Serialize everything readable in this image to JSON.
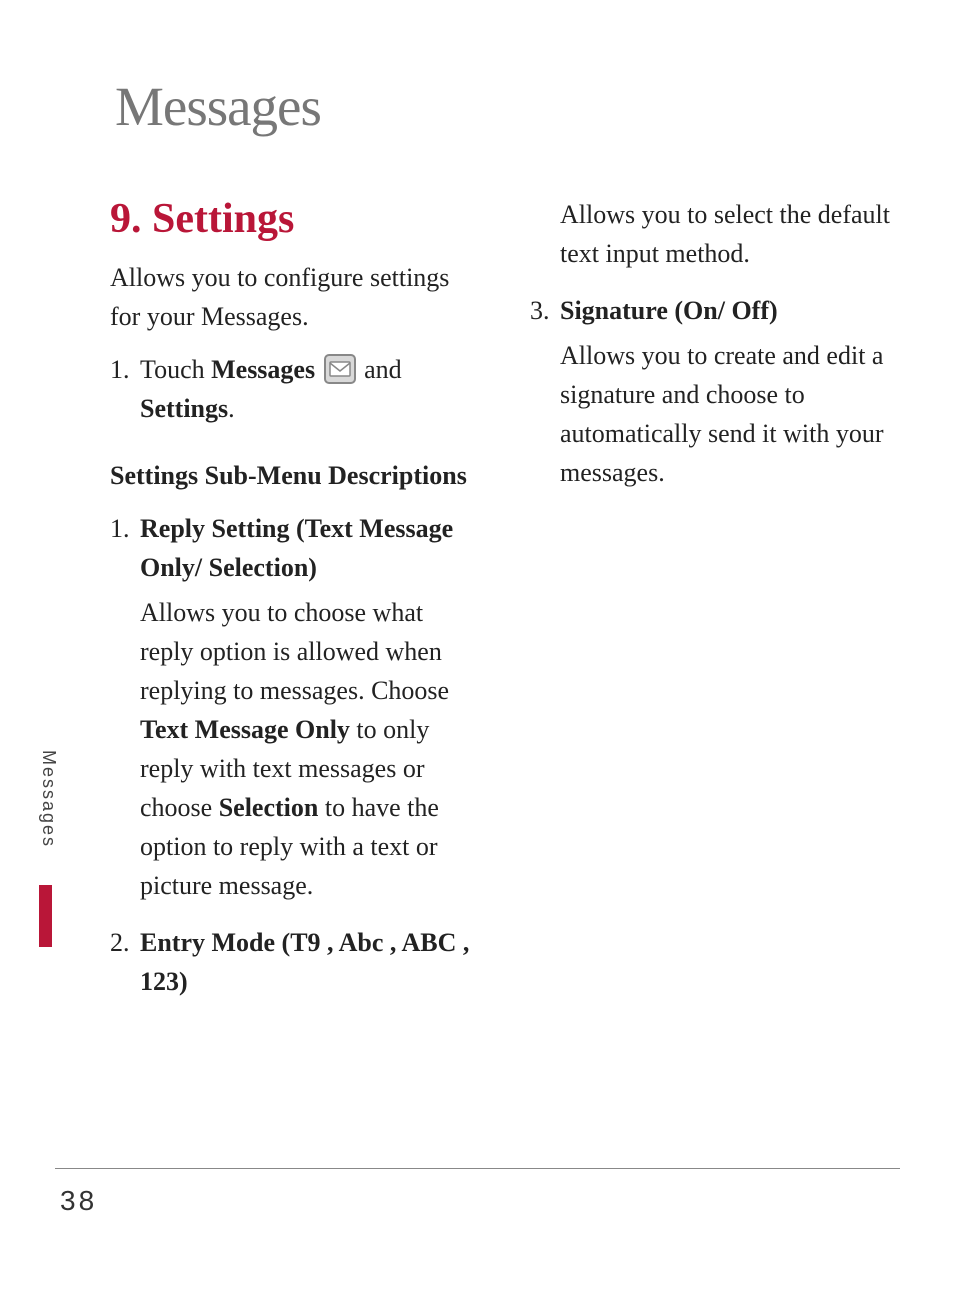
{
  "title": "Messages",
  "section_heading": "9. Settings",
  "intro": "Allows you to configure settings for your Messages.",
  "step1": {
    "num": "1.",
    "pre": "Touch ",
    "bold1": "Messages",
    "mid": " and ",
    "bold2": "Settings",
    "post": "."
  },
  "sub_heading": "Settings Sub-Menu Descriptions",
  "left_items": [
    {
      "num": "1.",
      "title": "Reply Setting (Text Message Only/ Selection)",
      "desc_pre": "Allows you to choose what reply option is allowed when replying to messages. Choose ",
      "desc_bold1": "Text Message Only",
      "desc_mid": " to only reply with text messages or choose ",
      "desc_bold2": "Selection",
      "desc_post": " to have the option to reply with a text or picture message."
    },
    {
      "num": "2.",
      "title": "Entry Mode (T9 , Abc , ABC , 123)",
      "desc_pre": "",
      "desc_bold1": "",
      "desc_mid": "",
      "desc_bold2": "",
      "desc_post": ""
    }
  ],
  "right_top_desc": "Allows you to select the default text input method.",
  "right_items": [
    {
      "num": "3.",
      "title": "Signature (On/ Off)",
      "desc": "Allows you to create and edit a signature and choose to automatically send it with your messages."
    }
  ],
  "sidebar_label": "Messages",
  "page_number": "38"
}
